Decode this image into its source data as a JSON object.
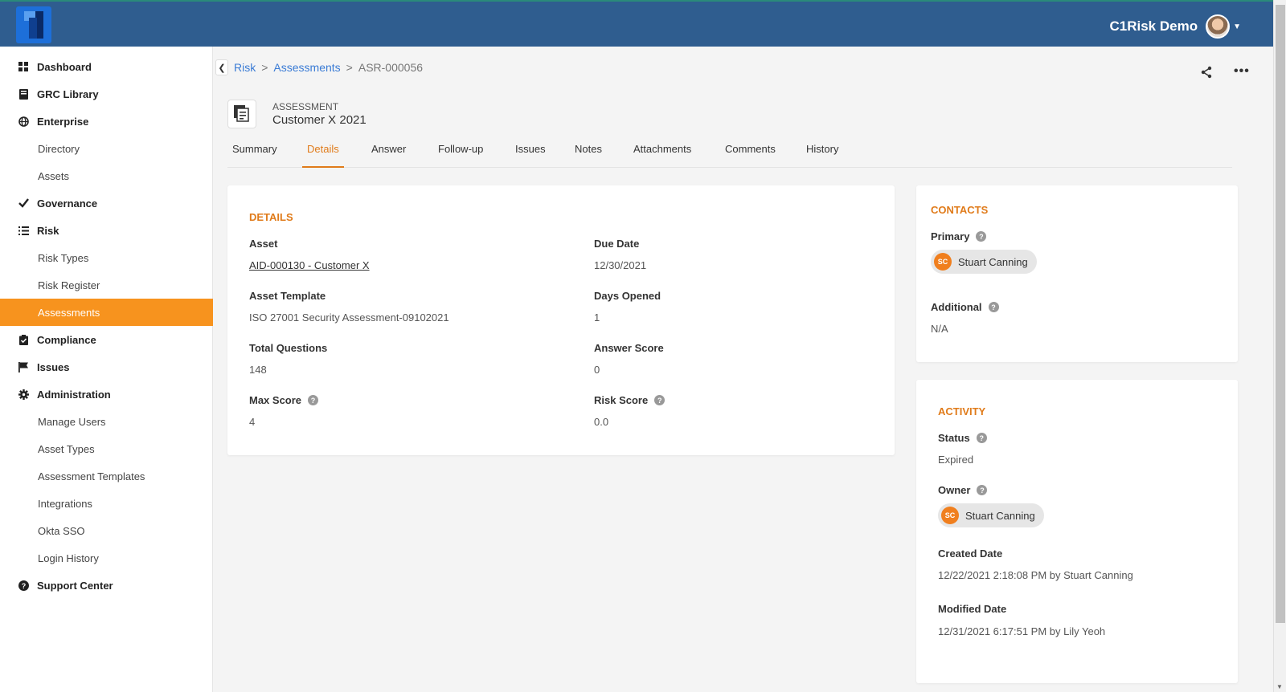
{
  "header": {
    "account_name": "C1Risk Demo"
  },
  "sidebar": {
    "items": [
      {
        "label": "Dashboard",
        "icon": "dashboard-icon",
        "level": "top"
      },
      {
        "label": "GRC Library",
        "icon": "book-icon",
        "level": "top"
      },
      {
        "label": "Enterprise",
        "icon": "globe-icon",
        "level": "top"
      },
      {
        "label": "Directory",
        "level": "sub"
      },
      {
        "label": "Assets",
        "level": "sub"
      },
      {
        "label": "Governance",
        "icon": "check-icon",
        "level": "top"
      },
      {
        "label": "Risk",
        "icon": "list-icon",
        "level": "top"
      },
      {
        "label": "Risk Types",
        "level": "sub"
      },
      {
        "label": "Risk Register",
        "level": "sub"
      },
      {
        "label": "Assessments",
        "level": "sub",
        "active": true
      },
      {
        "label": "Compliance",
        "icon": "clipboard-check-icon",
        "level": "top"
      },
      {
        "label": "Issues",
        "icon": "flag-icon",
        "level": "top"
      },
      {
        "label": "Administration",
        "icon": "gear-icon",
        "level": "top"
      },
      {
        "label": "Manage Users",
        "level": "sub"
      },
      {
        "label": "Asset Types",
        "level": "sub"
      },
      {
        "label": "Assessment Templates",
        "level": "sub"
      },
      {
        "label": "Integrations",
        "level": "sub"
      },
      {
        "label": "Okta SSO",
        "level": "sub"
      },
      {
        "label": "Login History",
        "level": "sub"
      },
      {
        "label": "Support Center",
        "icon": "question-circle-icon",
        "level": "top"
      }
    ]
  },
  "breadcrumb": {
    "items": [
      "Risk",
      "Assessments",
      "ASR-000056"
    ],
    "separator": ">"
  },
  "record": {
    "type": "ASSESSMENT",
    "name": "Customer X 2021"
  },
  "tabs": [
    {
      "label": "Summary"
    },
    {
      "label": "Details",
      "active": true
    },
    {
      "label": "Answer"
    },
    {
      "label": "Follow-up"
    },
    {
      "label": "Issues"
    },
    {
      "label": "Notes"
    },
    {
      "label": "Attachments"
    },
    {
      "label": "Comments"
    },
    {
      "label": "History"
    }
  ],
  "details": {
    "title": "DETAILS",
    "asset_label": "Asset",
    "asset_value": "AID-000130 - Customer X",
    "due_date_label": "Due Date",
    "due_date_value": "12/30/2021",
    "asset_template_label": "Asset Template",
    "asset_template_value": "ISO 27001 Security Assessment-09102021",
    "days_opened_label": "Days Opened",
    "days_opened_value": "1",
    "total_questions_label": "Total Questions",
    "total_questions_value": "148",
    "answer_score_label": "Answer Score",
    "answer_score_value": "0",
    "max_score_label": "Max Score",
    "max_score_value": "4",
    "risk_score_label": "Risk Score",
    "risk_score_value": "0.0"
  },
  "contacts": {
    "title": "CONTACTS",
    "primary_label": "Primary",
    "primary_initials": "SC",
    "primary_name": "Stuart Canning",
    "additional_label": "Additional",
    "additional_value": "N/A"
  },
  "activity": {
    "title": "ACTIVITY",
    "status_label": "Status",
    "status_value": "Expired",
    "owner_label": "Owner",
    "owner_initials": "SC",
    "owner_name": "Stuart Canning",
    "created_label": "Created Date",
    "created_value": "12/22/2021 2:18:08 PM by Stuart Canning",
    "modified_label": "Modified Date",
    "modified_value": "12/31/2021 6:17:51 PM by Lily Yeoh"
  },
  "colors": {
    "topbar": "#2f5d8f",
    "accent": "#f7931e",
    "section_title": "#e07b1a",
    "link": "#3a7bd5",
    "avatar": "#f07f1e"
  }
}
